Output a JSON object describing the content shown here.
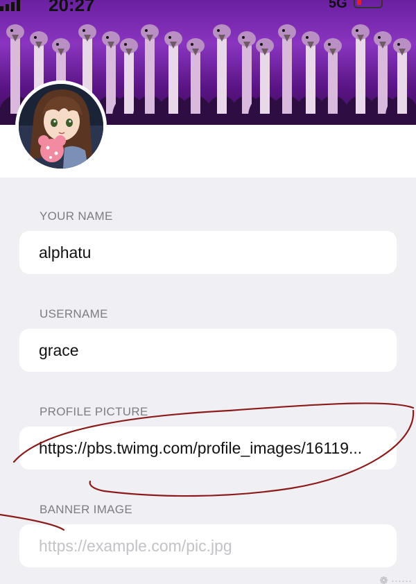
{
  "status_bar": {
    "time": "20:27",
    "network": "5G"
  },
  "banner": {
    "image": "purple-birds-banner"
  },
  "avatar": {
    "image": "anime-girl-avatar"
  },
  "form": {
    "name": {
      "label": "YOUR NAME",
      "value": "alphatu"
    },
    "username": {
      "label": "USERNAME",
      "value": "grace"
    },
    "profile_picture": {
      "label": "PROFILE PICTURE",
      "value": "https://pbs.twimg.com/profile_images/16119..."
    },
    "banner_image": {
      "label": "BANNER IMAGE",
      "value": "",
      "placeholder": "https://example.com/pic.jpg"
    }
  },
  "colors": {
    "annotation": "#8b1a1a",
    "banner": "#7a2db5"
  }
}
